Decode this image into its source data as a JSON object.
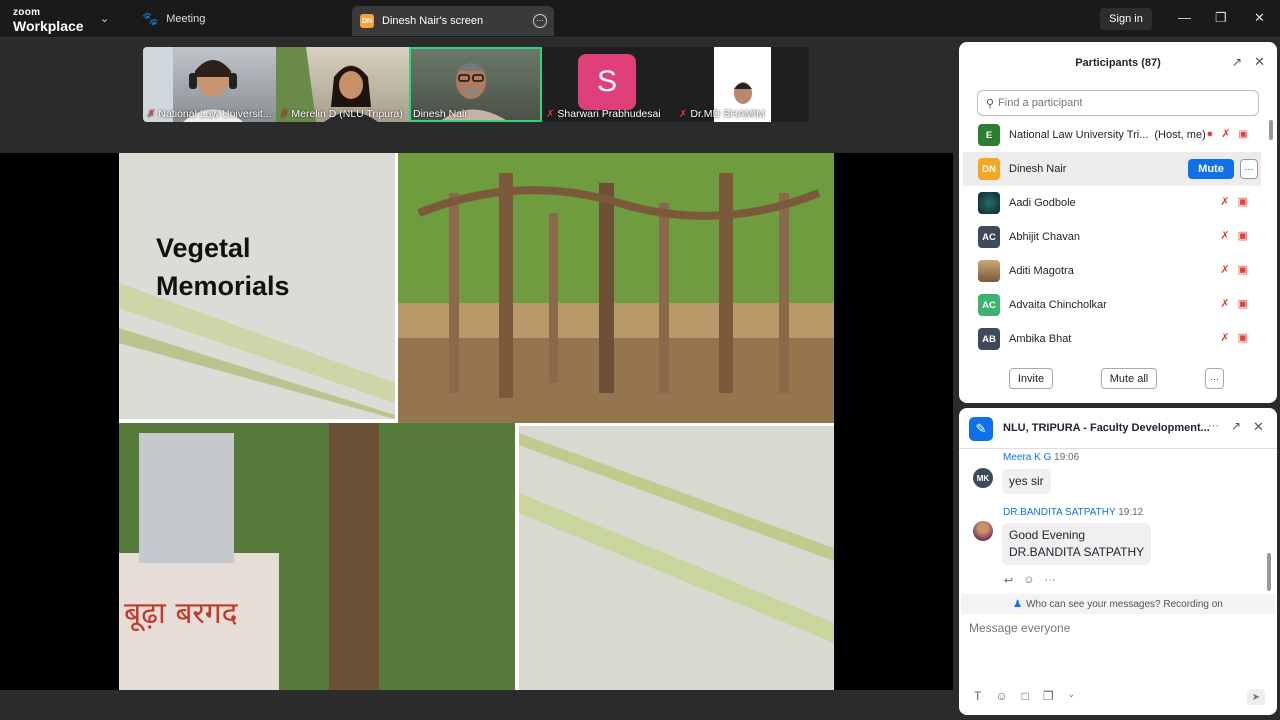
{
  "app": {
    "logo_top": "zoom",
    "logo_bottom": "Workplace"
  },
  "tabs": {
    "meeting": "Meeting",
    "screen": "Dinesh Nair's screen",
    "screen_badge": "DN"
  },
  "topbar": {
    "signin": "Sign in"
  },
  "videos": [
    {
      "name": "National Law Universit..."
    },
    {
      "name": "Merelin D (NLU Tripura)"
    },
    {
      "name": "Dinesh Nair"
    },
    {
      "name": "Sharwari Prabhudesai",
      "initial": "S"
    },
    {
      "name": "Dr.MD SHAMIM"
    }
  ],
  "slide": {
    "title_line1": "Vegetal",
    "title_line2": "Memorials",
    "plaque_text": "बूढ़ा बरगद"
  },
  "participants": {
    "title": "Participants (87)",
    "search_placeholder": "Find a participant",
    "rows": [
      {
        "initials": "E",
        "name": "National Law University Tri...",
        "tag": "(Host, me)",
        "color": "#2e7d32"
      },
      {
        "initials": "DN",
        "name": "Dinesh Nair",
        "color": "#f5a623"
      },
      {
        "initials": "",
        "name": "Aadi Godbole",
        "color": "#234"
      },
      {
        "initials": "AC",
        "name": "Abhijit Chavan",
        "color": "#3d4a5c"
      },
      {
        "initials": "",
        "name": "Aditi Magotra",
        "color": "#a0805a"
      },
      {
        "initials": "AC",
        "name": "Advaita Chincholkar",
        "color": "#3cb371"
      },
      {
        "initials": "AB",
        "name": "Ambika Bhat",
        "color": "#3d4a5c"
      }
    ],
    "mute_btn": "Mute",
    "invite": "Invite",
    "mute_all": "Mute all"
  },
  "chat": {
    "title": "NLU, TRIPURA  - Faculty Development...",
    "messages": [
      {
        "avatar": "MK",
        "sender": "Meera K G",
        "time": "19:06",
        "text_lines": [
          "yes sir"
        ]
      },
      {
        "avatar": "",
        "sender": "DR.BANDITA SATPATHY",
        "time": "19:12",
        "text_lines": [
          "Good Evening",
          "DR.BANDITA SATPATHY"
        ]
      }
    ],
    "notice": "Who can see your messages? Recording on",
    "input_placeholder": "Message everyone"
  }
}
